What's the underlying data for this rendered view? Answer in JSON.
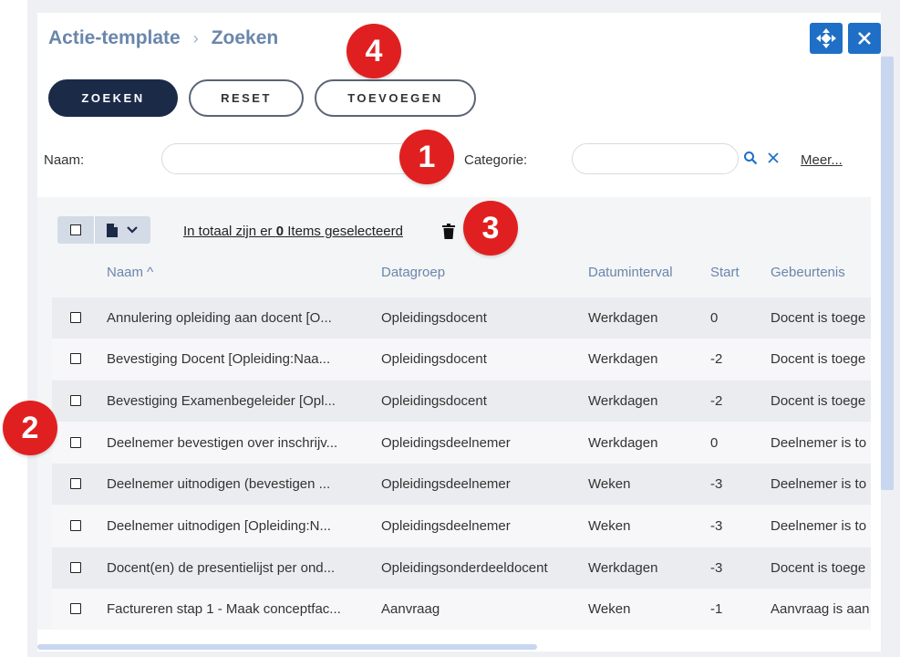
{
  "breadcrumb": {
    "parent": "Actie-template",
    "separator": "›",
    "current": "Zoeken"
  },
  "window_buttons": {
    "move_icon": "move-arrows-icon",
    "close_icon": "close-icon"
  },
  "toolbar": {
    "search_label": "ZOEKEN",
    "reset_label": "RESET",
    "add_label": "TOEVOEGEN"
  },
  "filters": {
    "name_label": "Naam:",
    "name_value": "",
    "category_label": "Categorie:",
    "category_value": "",
    "more_label": "Meer..."
  },
  "selection": {
    "prefix": "In totaal zijn er ",
    "count": "0",
    "suffix": " Items geselecteerd"
  },
  "columns": {
    "name": "Naam ^",
    "datagroup": "Datagroep",
    "interval": "Datuminterval",
    "start": "Start",
    "event": "Gebeurtenis"
  },
  "rows": [
    {
      "name": "Annulering opleiding aan docent [O...",
      "datagroup": "Opleidingsdocent",
      "interval": "Werkdagen",
      "start": "0",
      "event": "Docent is toege"
    },
    {
      "name": "Bevestiging Docent [Opleiding:Naa...",
      "datagroup": "Opleidingsdocent",
      "interval": "Werkdagen",
      "start": "-2",
      "event": "Docent is toege"
    },
    {
      "name": "Bevestiging Examenbegeleider [Opl...",
      "datagroup": "Opleidingsdocent",
      "interval": "Werkdagen",
      "start": "-2",
      "event": "Docent is toege"
    },
    {
      "name": "Deelnemer bevestigen over inschrijv...",
      "datagroup": "Opleidingsdeelnemer",
      "interval": "Werkdagen",
      "start": "0",
      "event": "Deelnemer is to"
    },
    {
      "name": "Deelnemer uitnodigen (bevestigen ...",
      "datagroup": "Opleidingsdeelnemer",
      "interval": "Weken",
      "start": "-3",
      "event": "Deelnemer is to"
    },
    {
      "name": "Deelnemer uitnodigen [Opleiding:N...",
      "datagroup": "Opleidingsdeelnemer",
      "interval": "Weken",
      "start": "-3",
      "event": "Deelnemer is to"
    },
    {
      "name": "Docent(en) de presentielijst per ond...",
      "datagroup": "Opleidingsonderdeeldocent",
      "interval": "Werkdagen",
      "start": "-3",
      "event": "Docent is toege"
    },
    {
      "name": "Factureren stap 1 - Maak conceptfac...",
      "datagroup": "Aanvraag",
      "interval": "Weken",
      "start": "-1",
      "event": "Aanvraag is aan"
    }
  ],
  "badges": {
    "b1": "1",
    "b2": "2",
    "b3": "3",
    "b4": "4"
  },
  "colors": {
    "primary": "#1b2a47",
    "accent": "#1f6fc6",
    "header_text": "#6a86ab",
    "badge": "#e02020"
  }
}
